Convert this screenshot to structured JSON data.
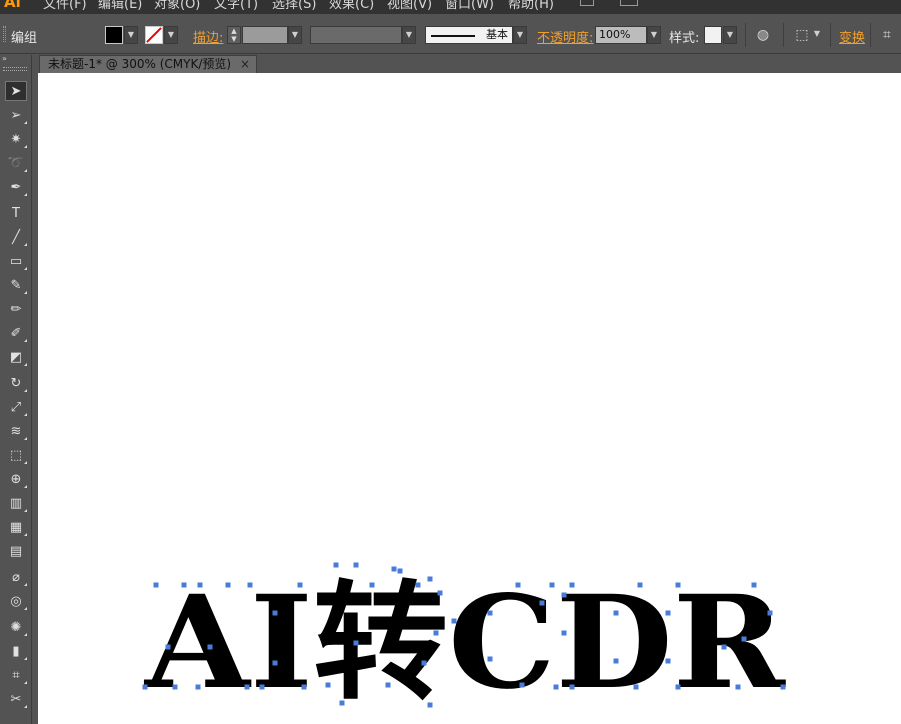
{
  "app": {
    "logo": "Ai"
  },
  "menu": [
    "文件(F)",
    "编辑(E)",
    "对象(O)",
    "文字(T)",
    "选择(S)",
    "效果(C)",
    "视图(V)",
    "窗口(W)",
    "帮助(H)"
  ],
  "controlbar": {
    "selection_label": "编组",
    "stroke_label": "描边:",
    "stroke_profile_label": "基本",
    "opacity_label": "不透明度:",
    "opacity_value": "100%",
    "style_label": "样式:",
    "transform_label": "变换"
  },
  "document": {
    "tab_title": "未标题-1* @ 300% (CMYK/预览)",
    "close_glyph": "×"
  },
  "artwork": {
    "text": "AI转CDR",
    "fill_color": "#000000",
    "anchor_color": "#4a7bd9"
  },
  "tools": [
    "selection-tool",
    "direct-selection-tool",
    "magic-wand-tool",
    "lasso-tool",
    "pen-tool",
    "type-tool",
    "line-segment-tool",
    "rectangle-tool",
    "paintbrush-tool",
    "pencil-tool",
    "blob-brush-tool",
    "eraser-tool",
    "rotate-tool",
    "scale-tool",
    "warp-tool",
    "free-transform-tool",
    "shape-builder-tool",
    "perspective-grid-tool",
    "mesh-tool",
    "gradient-tool",
    "eyedropper-tool",
    "blend-tool",
    "symbol-sprayer-tool",
    "column-graph-tool",
    "artboard-tool",
    "slice-tool"
  ]
}
